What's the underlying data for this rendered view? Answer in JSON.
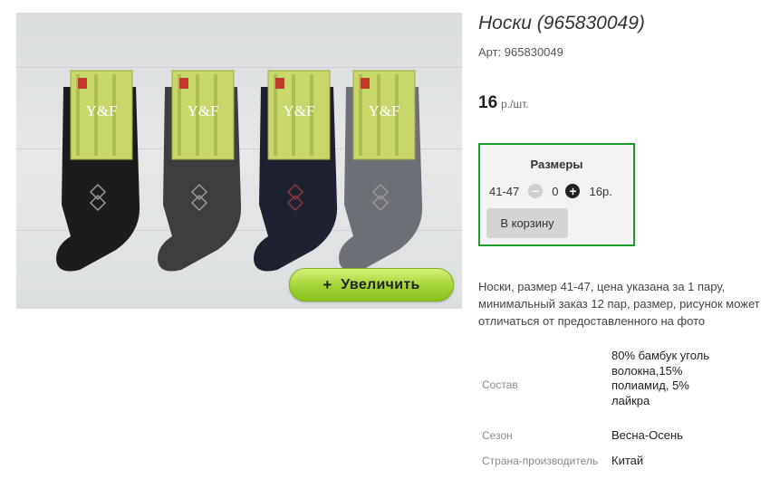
{
  "product": {
    "title": "Носки (965830049)",
    "article": "Арт: 965830049",
    "price_value": "16",
    "price_unit": "р./шт."
  },
  "image": {
    "zoom_plus": "+",
    "zoom_label": "Увеличить",
    "sock_colors": [
      "#1c1c1c",
      "#3e3e3e",
      "#1e2230",
      "#6e7077"
    ],
    "package_color": "#c9d66a",
    "brand_mark": "Y&F"
  },
  "sizes": {
    "heading": "Размеры",
    "rows": [
      {
        "size": "41-47",
        "quantity": "0",
        "price": "16р."
      }
    ],
    "minus_icon": "−",
    "plus_icon": "+",
    "cart_button": "В корзину"
  },
  "description": {
    "lines": [
      "Носки, размер 41-47, цена указана за 1 пару,",
      "минимальный заказ 12 пар, размер, рисунок может",
      "отличаться от предоставленного на фото"
    ]
  },
  "specs": [
    {
      "label": "Состав",
      "value": "80% бамбук уголь волокна,15% полиамид, 5% лайкра"
    },
    {
      "label": "Сезон",
      "value": "Весна-Осень"
    },
    {
      "label": "Страна-производитель",
      "value": "Китай"
    }
  ],
  "colors": {
    "accent_border": "#1f9a2c",
    "zoom_button": "#a3d336"
  }
}
